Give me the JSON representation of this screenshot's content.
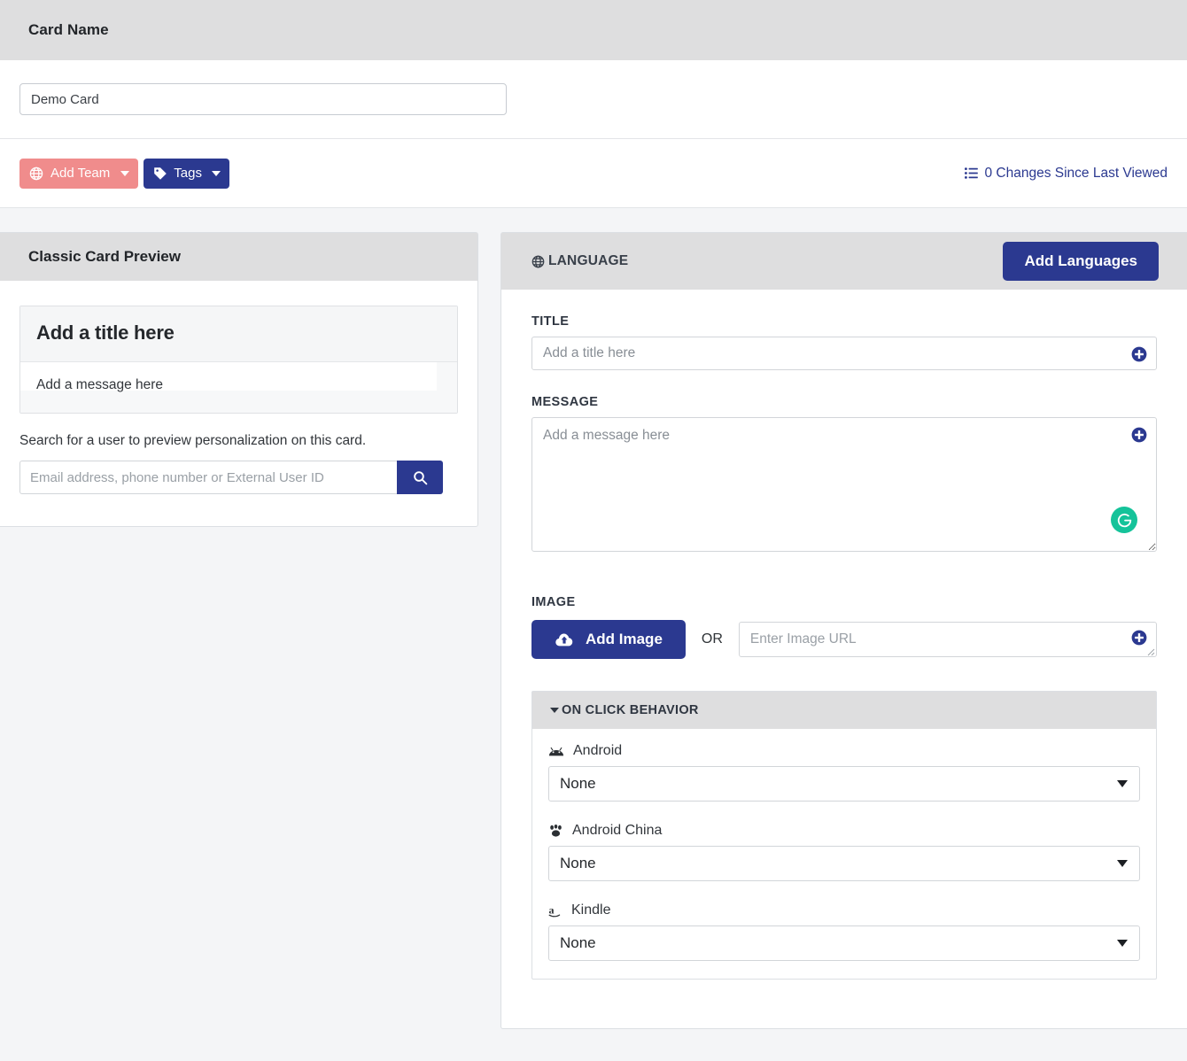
{
  "header": {
    "title": "Card Name",
    "name_input_value": "Demo Card"
  },
  "toolbar": {
    "add_team_label": "Add Team",
    "tags_label": "Tags",
    "changes_label": "0 Changes Since Last Viewed",
    "add_team_color": "#f08c8c",
    "brand_navy": "#2b3990"
  },
  "preview": {
    "panel_title": "Classic Card Preview",
    "card_title": "Add a title here",
    "card_message": "Add a message here",
    "search_help": "Search for a user to preview personalization on this card.",
    "search_placeholder": "Email address, phone number or External User ID"
  },
  "language": {
    "section_label": "LANGUAGE",
    "add_languages_label": "Add Languages",
    "title_label": "TITLE",
    "title_placeholder": "Add a title here",
    "message_label": "MESSAGE",
    "message_placeholder": "Add a message here",
    "image_label": "IMAGE",
    "add_image_label": "Add Image",
    "or_label": "OR",
    "image_url_placeholder": "Enter Image URL"
  },
  "on_click": {
    "section_label": "ON CLICK BEHAVIOR",
    "platforms": [
      {
        "name": "Android",
        "icon": "android-icon",
        "value": "None"
      },
      {
        "name": "Android China",
        "icon": "paw-icon",
        "value": "None"
      },
      {
        "name": "Kindle",
        "icon": "amazon-icon",
        "value": "None"
      }
    ]
  }
}
